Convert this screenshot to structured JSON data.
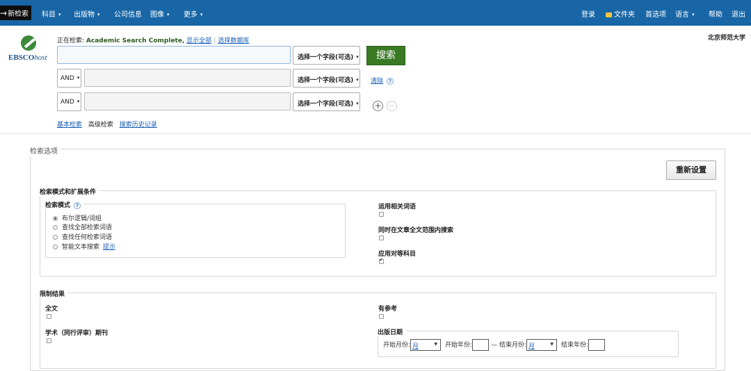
{
  "topbar": {
    "new_search": "新检索",
    "nav": [
      "科目",
      "出版物",
      "公司信息",
      "图像",
      "更多"
    ],
    "right": {
      "login": "登录",
      "folder": "文件夹",
      "preferences": "首选项",
      "language": "语言",
      "help": "帮助",
      "exit": "退出"
    }
  },
  "logo": {
    "brand": "EBSCO",
    "host": "host"
  },
  "institution": "北京师范大学",
  "searching": {
    "prefix": "正在检索:",
    "database": "Academic Search Complete,",
    "show_all": "显示全部",
    "choose_db": "选择数据库"
  },
  "search_rows": [
    {
      "bool": "",
      "field": "选择一个字段(可选)"
    },
    {
      "bool": "AND",
      "field": "选择一个字段(可选)"
    },
    {
      "bool": "AND",
      "field": "选择一个字段(可选)"
    }
  ],
  "search_button": "搜索",
  "clear": "清除",
  "help_icon": "?",
  "add_icon": "+",
  "remove_icon": "−",
  "links": {
    "basic": "基本检索",
    "advanced": "高级检索",
    "history": "搜索历史记录"
  },
  "options": {
    "title": "检索选项",
    "reset": "重新设置",
    "modes_section": "检索模式和扩展条件",
    "mode_label": "检索模式",
    "modes": [
      "布尔逻辑/词组",
      "查找全部检索词语",
      "查找任何检索词语",
      "智能文本搜索"
    ],
    "hint": "提示",
    "selected_mode": 0,
    "related_words": "运用相关词语",
    "fulltext_search": "同时在文章全文范围内搜索",
    "equivalent_subjects": "应用对等科目",
    "equivalent_subjects_checked": true
  },
  "limits": {
    "title": "限制结果",
    "full_text": "全文",
    "has_references": "有参考",
    "peer_reviewed": "学术（同行评审）期刊",
    "pub_date": "出版日期",
    "start_month": "开始月份:",
    "start_year": "开始年份:",
    "dash": "—",
    "end_month": "结束月份:",
    "end_year": "结束年份:",
    "month_value": "月"
  }
}
